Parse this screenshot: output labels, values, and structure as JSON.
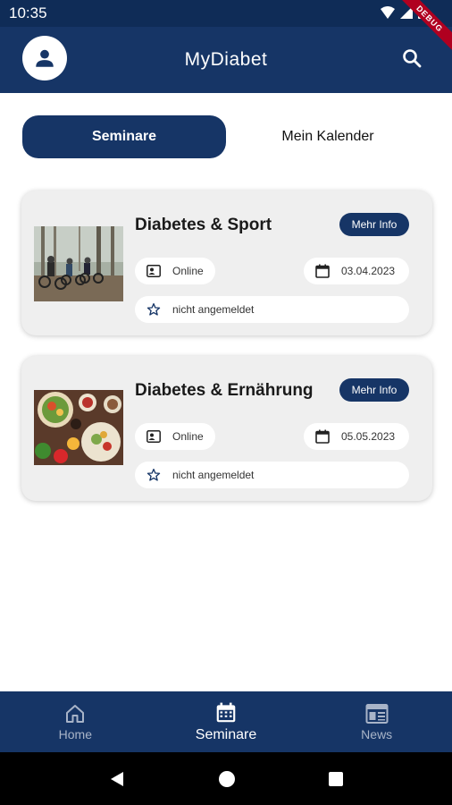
{
  "status_bar": {
    "time": "10:35",
    "debug_label": "DEBUG"
  },
  "app_bar": {
    "title": "MyDiabet"
  },
  "tabs": [
    {
      "label": "Seminare",
      "active": true
    },
    {
      "label": "Mein Kalender",
      "active": false
    }
  ],
  "seminars": [
    {
      "title": "Diabetes & Sport",
      "info_label": "Mehr Info",
      "mode": "Online",
      "date": "03.04.2023",
      "status": "nicht angemeldet",
      "image": "cyclists-in-forest"
    },
    {
      "title": "Diabetes & Ernährung",
      "info_label": "Mehr Info",
      "mode": "Online",
      "date": "05.05.2023",
      "status": "nicht angemeldet",
      "image": "healthy-food-bowls"
    }
  ],
  "bottom_nav": [
    {
      "label": "Home",
      "icon": "home-icon",
      "active": false
    },
    {
      "label": "Seminare",
      "icon": "calendar-icon",
      "active": true
    },
    {
      "label": "News",
      "icon": "news-icon",
      "active": false
    }
  ],
  "colors": {
    "primary": "#163566",
    "status_bar": "#0f2c57",
    "card": "#efefef",
    "inactive_nav": "#a8b4c8"
  }
}
